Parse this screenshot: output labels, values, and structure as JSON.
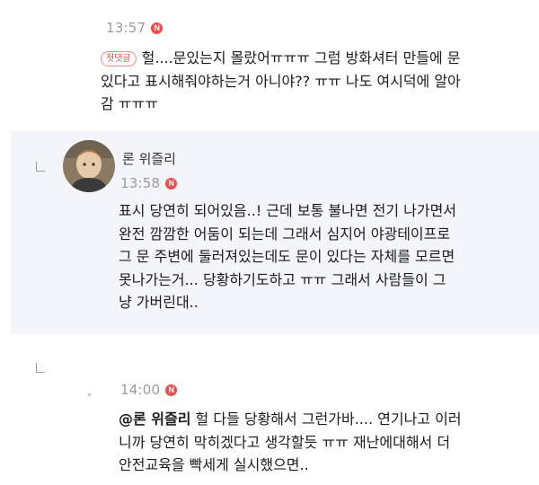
{
  "comment1": {
    "time": "13:57",
    "new_badge": "N",
    "tag": "첫댓글",
    "text_line1": "헐....문있는지 몰랐어ㅠㅠㅠ 그럼 방화셔터 만들에 문",
    "text_line2": "있다고 표시해줘야하는거 아니야?? ㅠㅠ 나도 여시덕에 알아",
    "text_line3": "감 ㅠㅠㅠ"
  },
  "reply1": {
    "nickname": "론 위즐리",
    "time": "13:58",
    "new_badge": "N",
    "text_lines": [
      "표시 당연히 되어있음..! 근데 보통 불나면 전기 나가면서",
      "완전 깜깜한 어둠이 되는데 그래서 심지어 야광테이프로",
      "그 문 주변에 둘러져있는데도 문이 있다는 자체를 모르면",
      "못나가는거... 당황하기도하고 ㅠㅠ 그래서 사람들이 그",
      "냥 가버린대.."
    ]
  },
  "reply2": {
    "time": "14:00",
    "new_badge": "N",
    "mention": "@론 위즐리",
    "text_line1": " 헐 다들 당황해서 그런가바.... 연기나고 이러",
    "text_line2": "니까 당연히 막히겠다고 생각할듯 ㅠㅠ 재난에대해서 더",
    "text_line3": "안전교육을 빡세게 실시했으면.."
  },
  "colors": {
    "reply_bg": "#f3f5fb",
    "new_dot": "#ee4b4b",
    "tag_border": "#f08a86"
  }
}
